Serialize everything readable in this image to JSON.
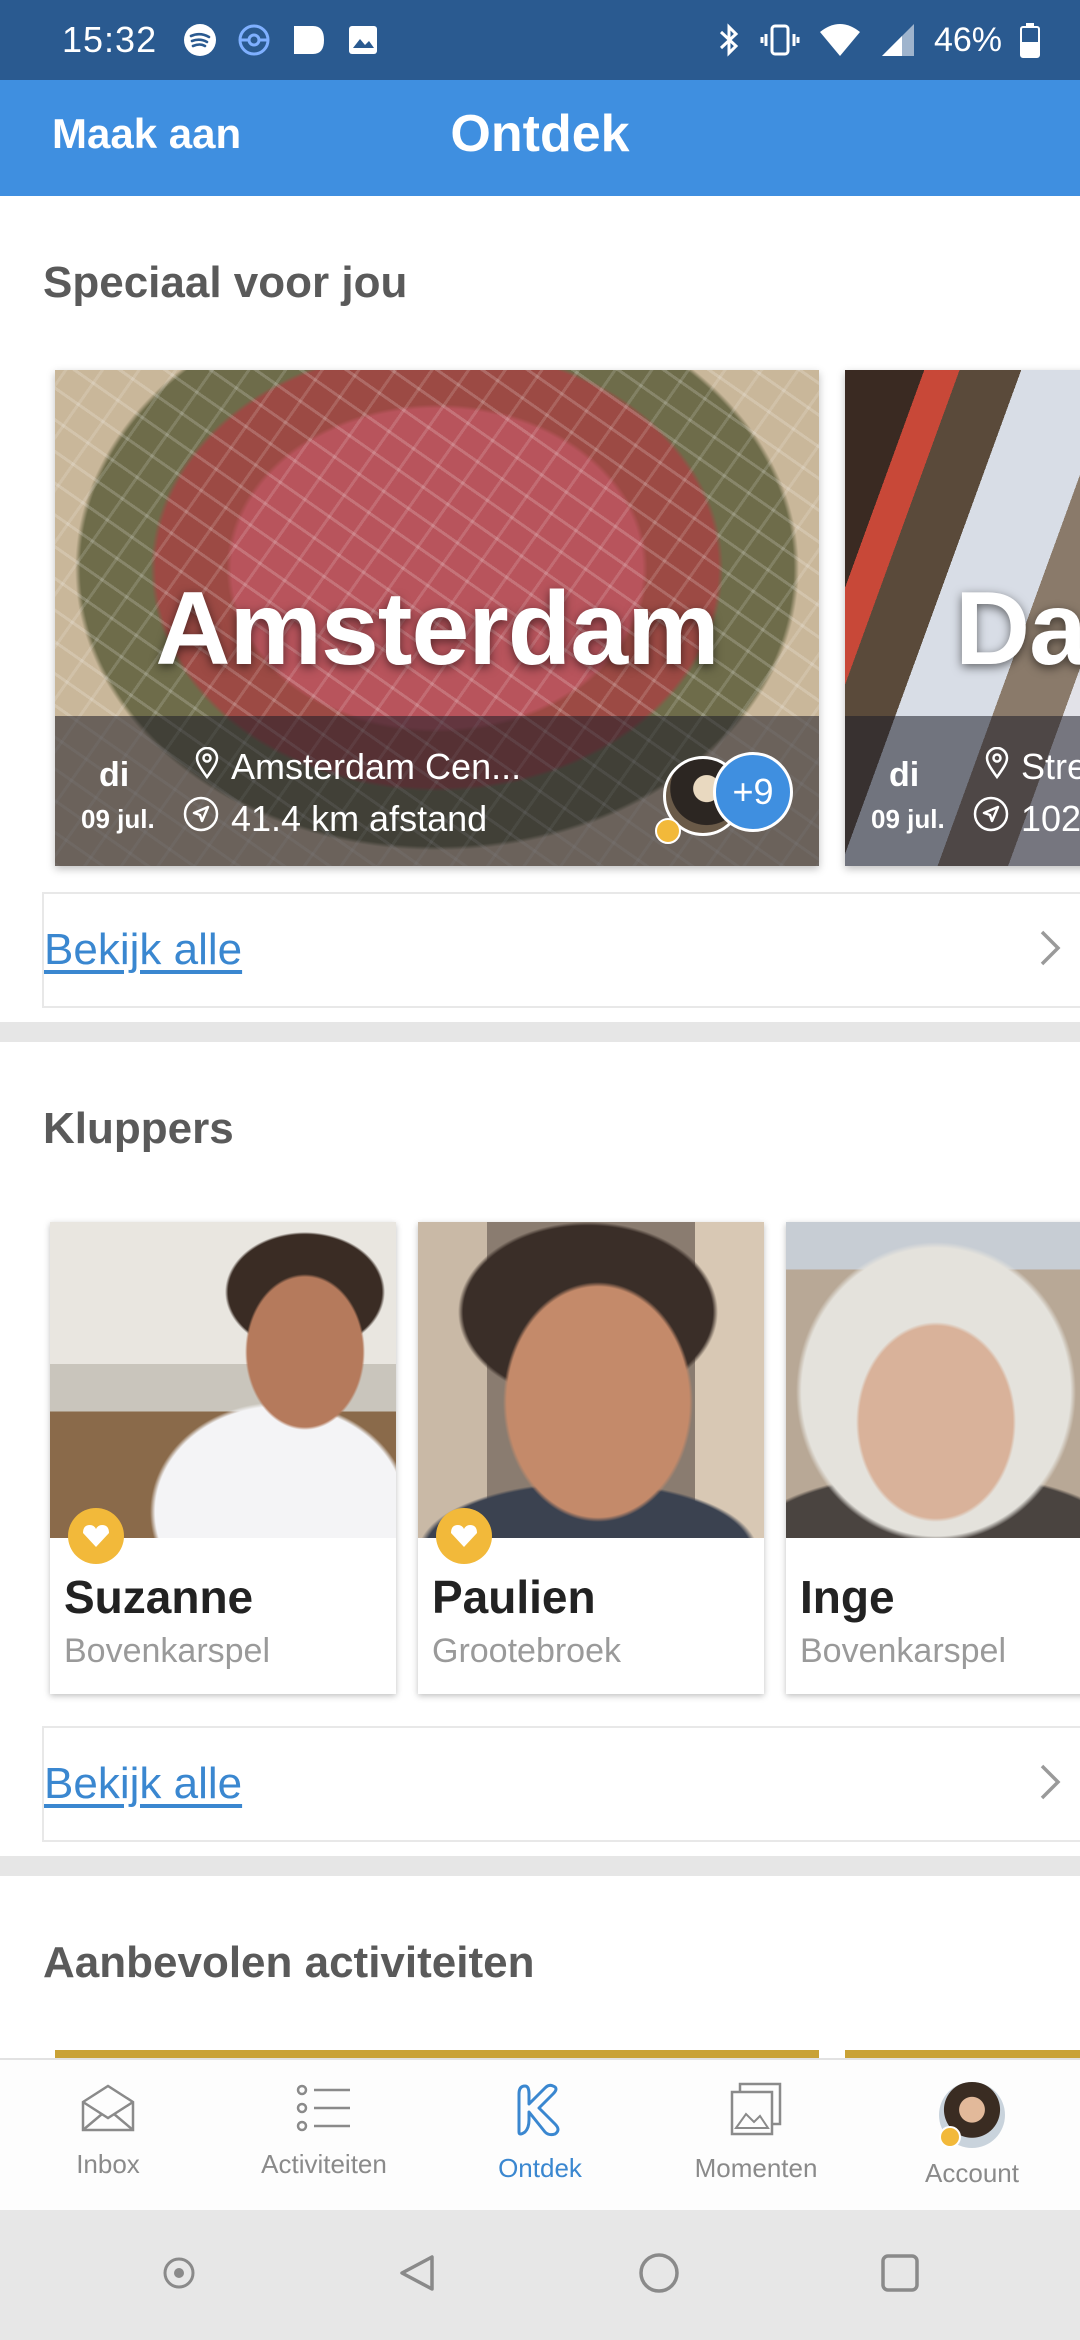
{
  "status_bar": {
    "time": "15:32",
    "battery": "46%"
  },
  "header": {
    "create_label": "Maak aan",
    "title": "Ontdek"
  },
  "special": {
    "title": "Speciaal voor jou",
    "cards": [
      {
        "city": "Amsterdam",
        "day": "di",
        "date": "09 jul.",
        "location": "Amsterdam Cen...",
        "distance": "41.4 km afstand",
        "more": "+9"
      },
      {
        "city": "Da",
        "day": "di",
        "date": "09 jul.",
        "location": "Stre",
        "distance": "102"
      }
    ],
    "view_all": "Bekijk alle"
  },
  "kluppers": {
    "title": "Kluppers",
    "people": [
      {
        "name": "Suzanne",
        "city": "Bovenkarspel"
      },
      {
        "name": "Paulien",
        "city": "Grootebroek"
      },
      {
        "name": "Inge",
        "city": "Bovenkarspel"
      }
    ],
    "view_all": "Bekijk alle"
  },
  "recommended": {
    "title": "Aanbevolen activiteiten"
  },
  "bottom_nav": {
    "items": [
      {
        "label": "Inbox",
        "icon": "inbox-icon"
      },
      {
        "label": "Activiteiten",
        "icon": "list-icon"
      },
      {
        "label": "Ontdek",
        "icon": "klup-logo-icon"
      },
      {
        "label": "Momenten",
        "icon": "photos-icon"
      },
      {
        "label": "Account",
        "icon": "avatar"
      }
    ],
    "active": "Ontdek"
  },
  "colors": {
    "header": "#3f8fe0",
    "status_bar": "#2a5a90",
    "accent": "#3a87d0",
    "badge": "#f2b93a"
  }
}
